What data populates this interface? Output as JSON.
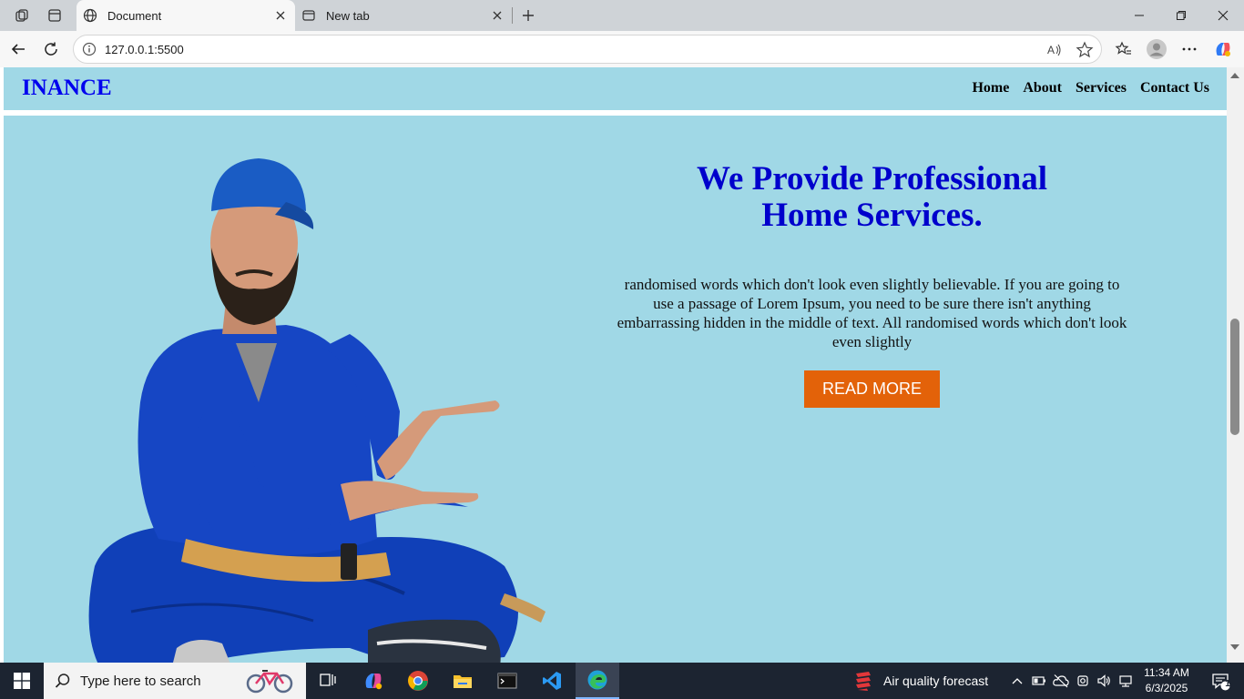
{
  "browser": {
    "tabs": [
      {
        "title": "Document",
        "active": true
      },
      {
        "title": "New tab",
        "active": false
      }
    ],
    "address": "127.0.0.1:5500"
  },
  "site": {
    "brand": "INANCE",
    "nav": [
      "Home",
      "About",
      "Services",
      "Contact Us"
    ],
    "hero": {
      "title_line1": "We Provide Professional",
      "title_line2": "Home Services.",
      "text": "randomised words which don't look even slightly believable. If you are going to use a passage of Lorem Ipsum, you need to be sure there isn't anything embarrassing hidden in the middle of text. All randomised words which don't look even slightly",
      "button": "READ MORE"
    }
  },
  "taskbar": {
    "search_placeholder": "Type here to search",
    "weather": "Air quality forecast",
    "time": "11:34 AM",
    "date": "6/3/2025",
    "notifications": "1"
  },
  "colors": {
    "header_bg": "#a0d8e6",
    "brand": "#0000ee",
    "hero_title": "#0000cc",
    "button": "#e36209"
  }
}
